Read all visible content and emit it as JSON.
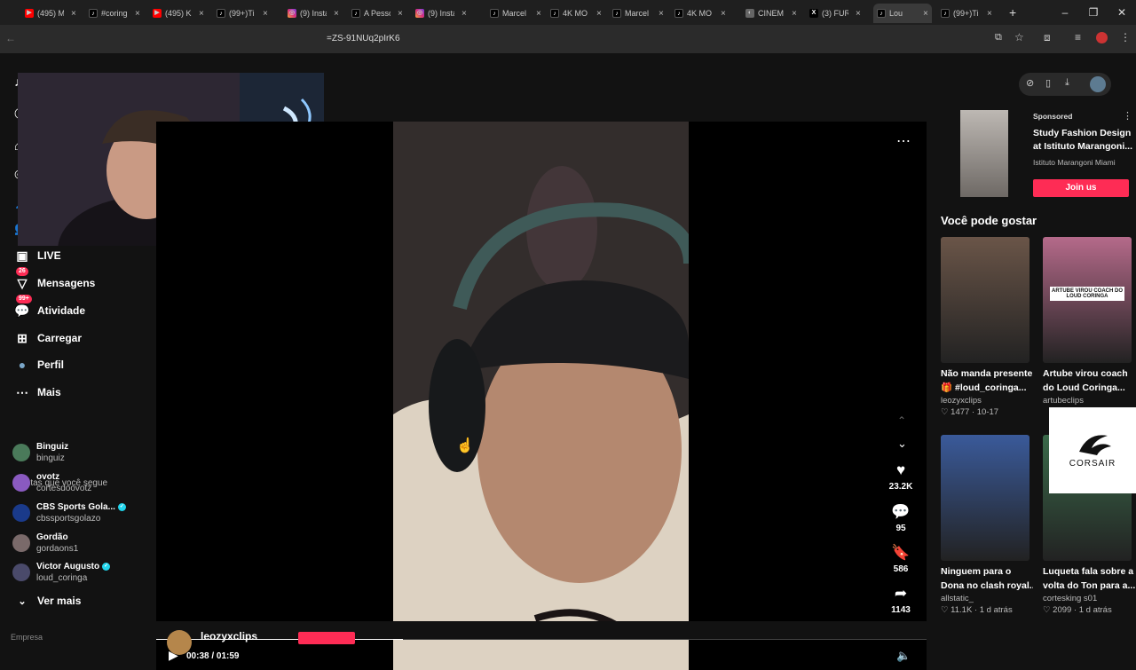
{
  "tabs": [
    {
      "title": "(495) M",
      "type": "yt"
    },
    {
      "title": "#coring",
      "type": "tt"
    },
    {
      "title": "(495) K",
      "type": "yt"
    },
    {
      "title": "(99+)Ti",
      "type": "tt"
    },
    {
      "title": "(9) Insta",
      "type": "ig"
    },
    {
      "title": "A Pesso",
      "type": "tt"
    },
    {
      "title": "(9) Insta",
      "type": "ig"
    },
    {
      "title": "Marcel",
      "type": "tt"
    },
    {
      "title": "4K MO",
      "type": "tt"
    },
    {
      "title": "Marcel",
      "type": "tt"
    },
    {
      "title": "4K MO",
      "type": "tt"
    },
    {
      "title": "CINEM",
      "type": "gen"
    },
    {
      "title": "(3) FUR",
      "type": "xx"
    },
    {
      "title": "Lou",
      "type": "tt",
      "active": true
    },
    {
      "title": "(99+)Ti",
      "type": "tt"
    }
  ],
  "address": {
    "url_fragment": "=ZS-91NUq2pIrK6"
  },
  "sidebar": {
    "nav": [
      {
        "label": "Seguindo",
        "icon": "following-icon"
      },
      {
        "label": "Amigos",
        "icon": "friends-icon"
      },
      {
        "label": "LIVE",
        "icon": "live-icon"
      },
      {
        "label": "Mensagens",
        "icon": "messages-icon",
        "badge": "26"
      },
      {
        "label": "Atividade",
        "icon": "activity-icon",
        "badge": "99+"
      },
      {
        "label": "Carregar",
        "icon": "upload-icon"
      },
      {
        "label": "Perfil",
        "icon": "profile-icon"
      },
      {
        "label": "Mais",
        "icon": "more-icon"
      }
    ],
    "following_title": "Contas que você segue",
    "accounts": [
      {
        "name": "Binguiz",
        "handle": "binguiz",
        "verified": false,
        "color": "#4a7a5a"
      },
      {
        "name": "ovotz",
        "handle": "cortesdoovotz",
        "verified": false,
        "color": "#8a5ac0"
      },
      {
        "name": "CBS Sports Gola...",
        "handle": "cbssportsgolazo",
        "verified": true,
        "color": "#1a3a8a"
      },
      {
        "name": "Gordão",
        "handle": "gordaons1",
        "verified": false,
        "color": "#7a6a6a"
      },
      {
        "name": "Victor Augusto",
        "handle": "loud_coringa",
        "verified": true,
        "color": "#4a4a6a"
      }
    ],
    "see_more": "Ver mais"
  },
  "player": {
    "current_time": "00:38 / 01:59",
    "progress": 0.32,
    "likes": "23.2K",
    "comments": "95",
    "saves": "586",
    "shares": "1143"
  },
  "ad": {
    "sponsored": "Sponsored",
    "title_line1": "Study Fashion Design",
    "title_line2": "at Istituto Marangoni...",
    "advertiser": "Istituto Marangoni Miami",
    "cta": "Join us"
  },
  "recommended": {
    "title": "Você pode gostar",
    "items": [
      {
        "line1": "Não manda presente",
        "line2": "🎁 #loud_coringa...",
        "user": "leozyxclips",
        "likes": "1477",
        "date": "10-17",
        "thumb": "#6a5548"
      },
      {
        "line1": "Artube virou coach",
        "line2": "do Loud Coringa...",
        "user": "artubeclips",
        "likes": "",
        "date": "",
        "thumb": "#b56a8a",
        "overlay": "ARTUBE VIROU COACH DO LOUD CORINGA"
      },
      {
        "line1": "Ninguem para o",
        "line2": "Dona no clash royal...",
        "user": "allstatic_",
        "likes": "11.1K",
        "date": "1 d atrás",
        "thumb": "#3a5a9a"
      },
      {
        "line1": "Luqueta fala sobre a",
        "line2": "volta do Ton para a...",
        "user": "cortesking s01",
        "likes": "2099",
        "date": "1 d atrás",
        "thumb": "#3a6a4a"
      }
    ]
  },
  "corsair": {
    "brand": "CORSAIR"
  },
  "bottom": {
    "username": "leozyxclips"
  }
}
